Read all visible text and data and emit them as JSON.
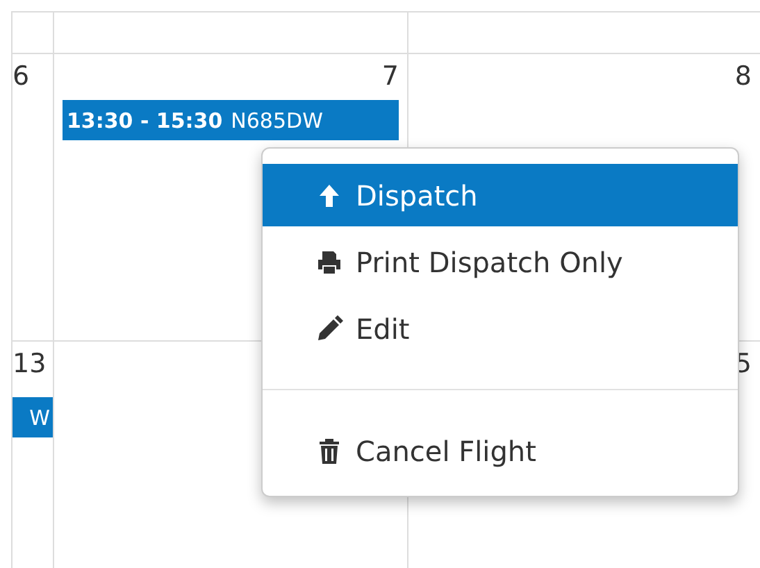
{
  "calendar": {
    "weeks": [
      {
        "days": [
          {
            "day": "6"
          },
          {
            "day": "7",
            "events": [
              {
                "time": "13:30 - 15:30",
                "title": "N685DW"
              }
            ]
          },
          {
            "day": "8"
          }
        ]
      },
      {
        "days": [
          {
            "day": "13",
            "events": [
              {
                "title": "W"
              }
            ]
          },
          {
            "day": "5"
          }
        ]
      }
    ]
  },
  "context_menu": {
    "items": [
      {
        "kind": "dispatch",
        "label": "Dispatch",
        "selected": true
      },
      {
        "kind": "print",
        "label": "Print Dispatch Only",
        "selected": false
      },
      {
        "kind": "edit",
        "label": "Edit",
        "selected": false
      },
      {
        "kind": "divider"
      },
      {
        "kind": "delete",
        "label": "Cancel Flight",
        "selected": false
      }
    ]
  }
}
